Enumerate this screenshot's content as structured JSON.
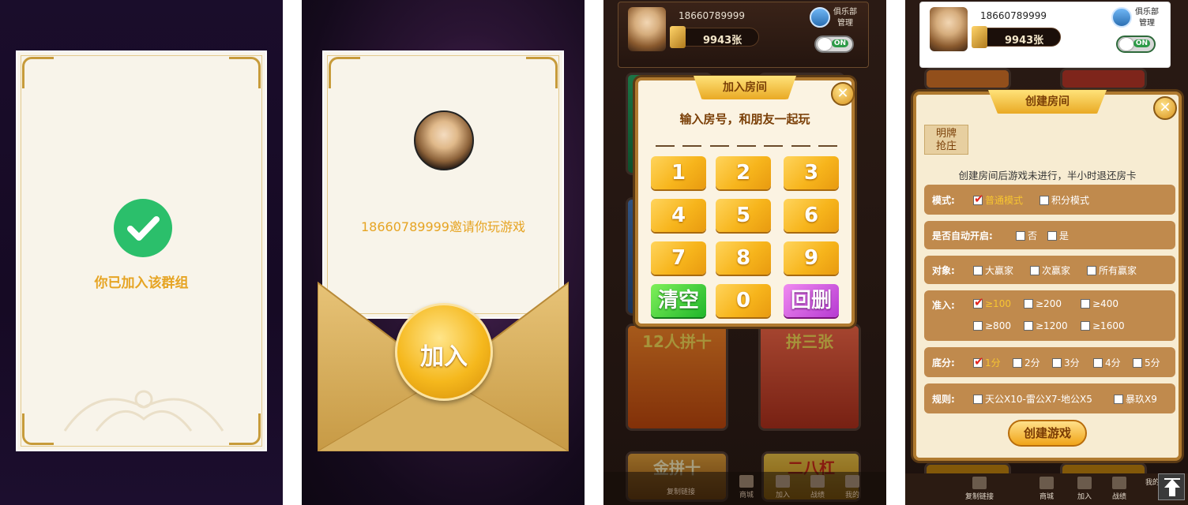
{
  "screen1": {
    "message": "你已加入该群组"
  },
  "screen2": {
    "invite_text": "18660789999邀请你玩游戏",
    "join_button": "加入"
  },
  "header": {
    "phone": "18660789999",
    "cards": "9943张",
    "club_label_line1": "俱乐部",
    "club_label_line2": "管理",
    "toggle_label": "ON"
  },
  "tiles": {
    "niuniu": "12人拼十",
    "sanzhang": "拼三张",
    "jinpin": "金拼十",
    "erba": "二八杠"
  },
  "join_room": {
    "title": "加入房间",
    "close": "✕",
    "prompt": "输入房号，和朋友一起玩",
    "keys": [
      "1",
      "2",
      "3",
      "4",
      "5",
      "6",
      "7",
      "8",
      "9",
      "清空",
      "0",
      "回删"
    ]
  },
  "create_room": {
    "title": "创建房间",
    "close": "✕",
    "tab_line1": "明牌",
    "tab_line2": "抢庄",
    "notice": "创建房间后游戏未进行，半小时退还房卡",
    "rows": {
      "mode": {
        "label": "模式:",
        "options": [
          "普通模式",
          "积分模式"
        ],
        "selected": "普通模式"
      },
      "auto_start": {
        "label": "是否自动开启:",
        "options": [
          "否",
          "是"
        ],
        "selected": ""
      },
      "target": {
        "label": "对象:",
        "options": [
          "大赢家",
          "次赢家",
          "所有赢家"
        ],
        "selected": ""
      },
      "entry": {
        "label": "准入:",
        "options": [
          "≥100",
          "≥200",
          "≥400",
          "≥800",
          "≥1200",
          "≥1600"
        ],
        "selected": "≥100"
      },
      "base": {
        "label": "底分:",
        "options": [
          "1分",
          "2分",
          "3分",
          "4分",
          "5分"
        ],
        "selected": "1分"
      },
      "rules": {
        "label": "规则:",
        "options": [
          "天公X10-雷公X7-地公X5",
          "暴玖X9"
        ],
        "selected": ""
      }
    },
    "submit": "创建游戏"
  },
  "bottom_nav": {
    "copy_link": "复制链接",
    "mall": "商城",
    "join": "加入",
    "records": "战绩",
    "mine": "我的"
  },
  "colors": {
    "gold": "#e6a423",
    "check_green": "#2bbf6b",
    "modal_border": "#b07a2f"
  }
}
